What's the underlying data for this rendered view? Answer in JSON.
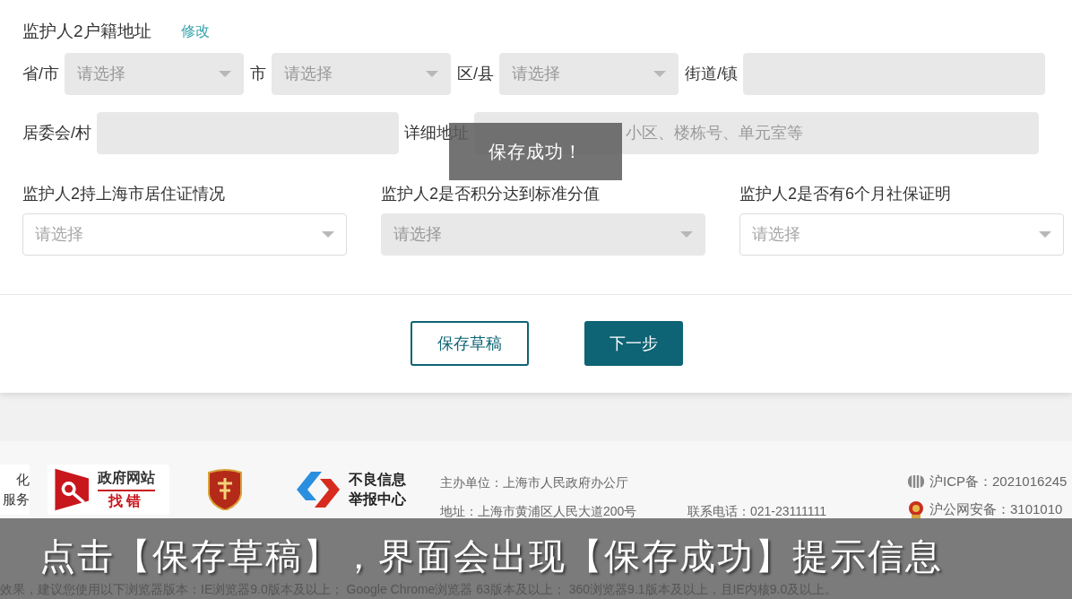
{
  "section": {
    "title": "监护人2户籍地址",
    "edit_link": "修改"
  },
  "address_row": [
    {
      "label": "省/市",
      "kind": "select",
      "placeholder": "请选择",
      "disabled": true
    },
    {
      "label": "市",
      "kind": "select",
      "placeholder": "请选择",
      "disabled": true
    },
    {
      "label": "区/县",
      "kind": "select",
      "placeholder": "请选择",
      "disabled": true
    },
    {
      "label": "街道/镇",
      "kind": "input",
      "disabled": true
    }
  ],
  "detail_row": [
    {
      "label": "居委会/村",
      "kind": "input",
      "disabled": true
    },
    {
      "label": "详细地址",
      "kind": "input",
      "placeholder": "小区、楼栋号、单元室等",
      "disabled": true
    }
  ],
  "questions": [
    {
      "label": "监护人2持上海市居住证情况",
      "placeholder": "请选择",
      "disabled": false
    },
    {
      "label": "监护人2是否积分达到标准分值",
      "placeholder": "请选择",
      "disabled": true
    },
    {
      "label": "监护人2是否有6个月社保证明",
      "placeholder": "请选择",
      "disabled": false
    }
  ],
  "buttons": [
    {
      "label": "保存草稿",
      "kind": "outline"
    },
    {
      "label": "下一步",
      "kind": "primary"
    }
  ],
  "toast": "保存成功！",
  "footer": {
    "logos": [
      {
        "kind": "partial",
        "lines": [
          "化",
          "服务"
        ]
      },
      {
        "kind": "gov-error",
        "lines": [
          "政府网站",
          "找错"
        ]
      },
      {
        "kind": "badge"
      },
      {
        "kind": "report",
        "lines": [
          "不良信息",
          "举报中心"
        ]
      }
    ],
    "info": [
      [
        "主办单位：上海市人民政府办公厅"
      ],
      [
        "地址：上海市黄浦区人民大道200号",
        "联系电话：021-23111111"
      ]
    ],
    "records": [
      {
        "kind": "icp",
        "text": "沪ICP备：2021016245"
      },
      {
        "kind": "police",
        "text": "沪公网安备：3101010"
      }
    ],
    "notice": "效果，建议您使用以下浏览器版本：IE浏览器9.0版本及以上； Google Chrome浏览器 63版本及以上； 360浏览器9.1版本及以上，且IE内核9.0及以上。"
  },
  "caption": "点击【保存草稿】，界面会出现【保存成功】提示信息"
}
